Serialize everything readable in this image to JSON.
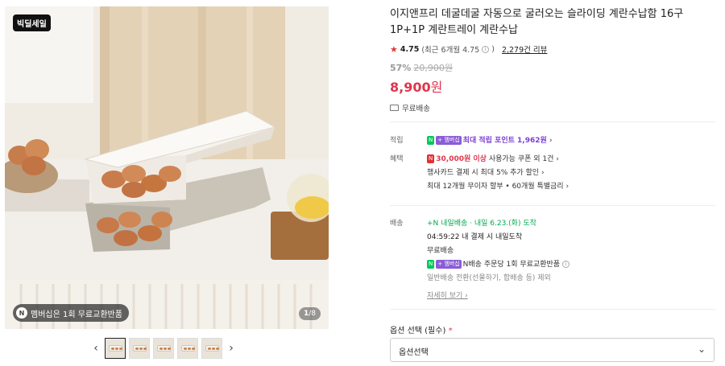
{
  "gallery": {
    "deal_badge": "빅딜세일",
    "membership_pill": "멤버십은 1회 무료교환반품",
    "membership_icon": "N",
    "counter_current": "1",
    "counter_total": "/8",
    "prev_label": "‹",
    "next_label": "›",
    "thumbnail_count": 6
  },
  "product": {
    "title": "이지앤프리 데굴데굴 자동으로 굴러오는 슬라이딩 계란수납함 16구 1P+1P 계란트레이 계란수납",
    "rating_star": "★",
    "rating_score": "4.75",
    "rating_recent": "(최근 6개월 4.75",
    "rating_info": "i",
    "rating_close": ")",
    "review_count": "2,279건 리뷰",
    "discount_rate": "57%",
    "original_price": "20,900원",
    "price_value": "8,900",
    "price_unit": "원",
    "shipping": "무료배송"
  },
  "benefits": {
    "points_label": "적립",
    "points_badge_n": "N",
    "points_badge_plus": "+ 멤버십",
    "points_text": "최대 적립 포인트 1,962원 ›",
    "benefit_label": "혜택",
    "coupon_badge": "N",
    "coupon_highlight": "30,000원 이상",
    "coupon_text": " 사용가능 쿠폰 외 1건 ›",
    "card_text": "행사카드 결제 시 최대 5% 추가 할인 ›",
    "installment_text": "최대 12개월 무이자 할부 • 60개월 특별금리 ›"
  },
  "delivery": {
    "label": "배송",
    "badge_text": "+N 내일배송",
    "arrival": " · 내일 6.23.(화) 도착",
    "cutoff": "04:59:22  내 결제 시 내일도착",
    "free": "무료배송",
    "nbadge_n": "N",
    "nbadge_plus": "+ 멤버십",
    "exchange": "N배송 주문당 1회 무료교환반품",
    "exchange_info": "i",
    "exclude": "일반배송 전환(선물하기, 합배송 등) 제외",
    "more": "자세히 보기 ›"
  },
  "options": {
    "label": "옵션 선택 (필수)",
    "required_mark": "*",
    "select_value": "옵션선택",
    "chevron": "⌄"
  },
  "colors": {
    "price_red": "#e0354c",
    "naver_green": "#03c75a",
    "membership_purple": "#8a5cd6"
  }
}
